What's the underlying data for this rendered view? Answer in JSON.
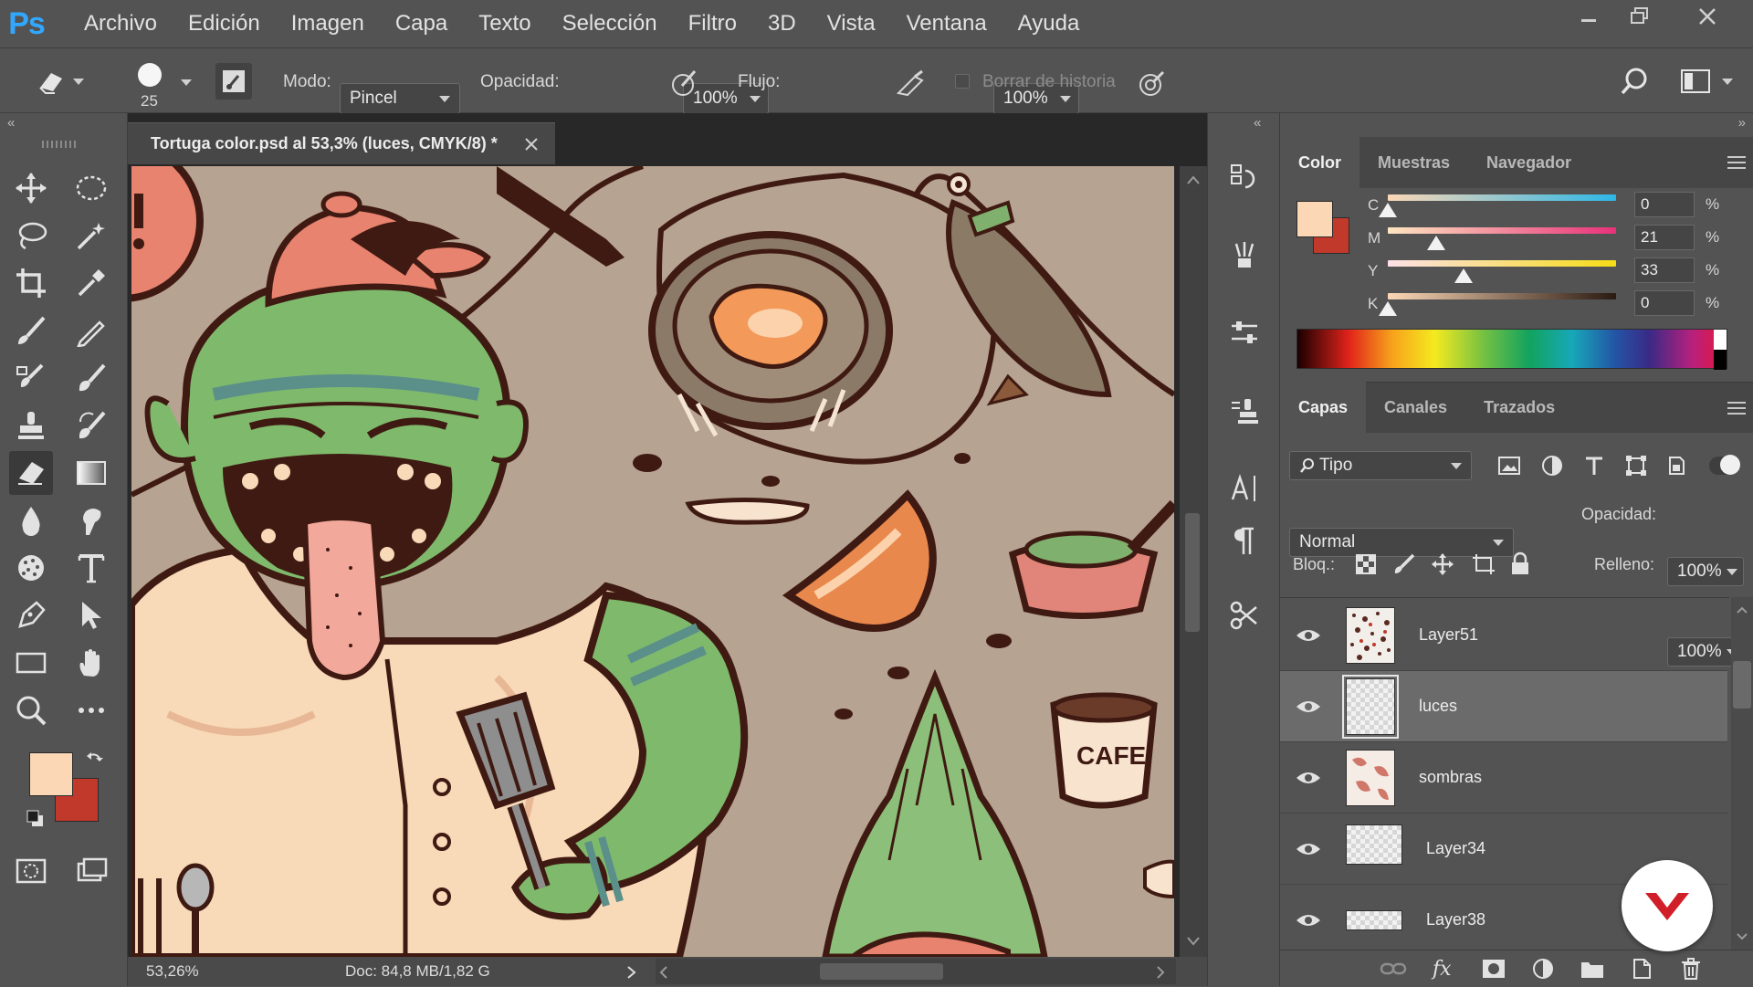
{
  "app": {
    "logo": "Ps",
    "menu": [
      "Archivo",
      "Edición",
      "Imagen",
      "Capa",
      "Texto",
      "Selección",
      "Filtro",
      "3D",
      "Vista",
      "Ventana",
      "Ayuda"
    ]
  },
  "options": {
    "brush_size": "25",
    "mode_label": "Modo:",
    "mode_value": "Pincel",
    "opacity_label": "Opacidad:",
    "opacity_value": "100%",
    "flow_label": "Flujo:",
    "flow_value": "100%",
    "erase_history_label": "Borrar de historia"
  },
  "document": {
    "tab_title": "Tortuga color.psd al 53,3% (luces, CMYK/8) *",
    "zoom": "53,26%",
    "doc_info": "Doc: 84,8 MB/1,82 G",
    "canvas_text": "CAFE"
  },
  "color_panel": {
    "tabs": [
      "Color",
      "Muestras",
      "Navegador"
    ],
    "channels": [
      {
        "label": "C",
        "value": "0",
        "level": 0
      },
      {
        "label": "M",
        "value": "21",
        "level": 21
      },
      {
        "label": "Y",
        "value": "33",
        "level": 33
      },
      {
        "label": "K",
        "value": "0",
        "level": 0
      }
    ],
    "unit": "%",
    "foreground": "#fcd7b6",
    "background": "#c0392b"
  },
  "layers_panel": {
    "tabs": [
      "Capas",
      "Canales",
      "Trazados"
    ],
    "filter_value": "Tipo",
    "blend_mode": "Normal",
    "opacity_label": "Opacidad:",
    "opacity_value": "100%",
    "lock_label": "Bloq.:",
    "fill_label": "Relleno:",
    "fill_value": "100%",
    "layers": [
      {
        "name": "Layer51",
        "selected": false
      },
      {
        "name": "luces",
        "selected": true
      },
      {
        "name": "sombras",
        "selected": false
      },
      {
        "name": "Layer34",
        "selected": false
      },
      {
        "name": "Layer38",
        "selected": false
      }
    ]
  }
}
